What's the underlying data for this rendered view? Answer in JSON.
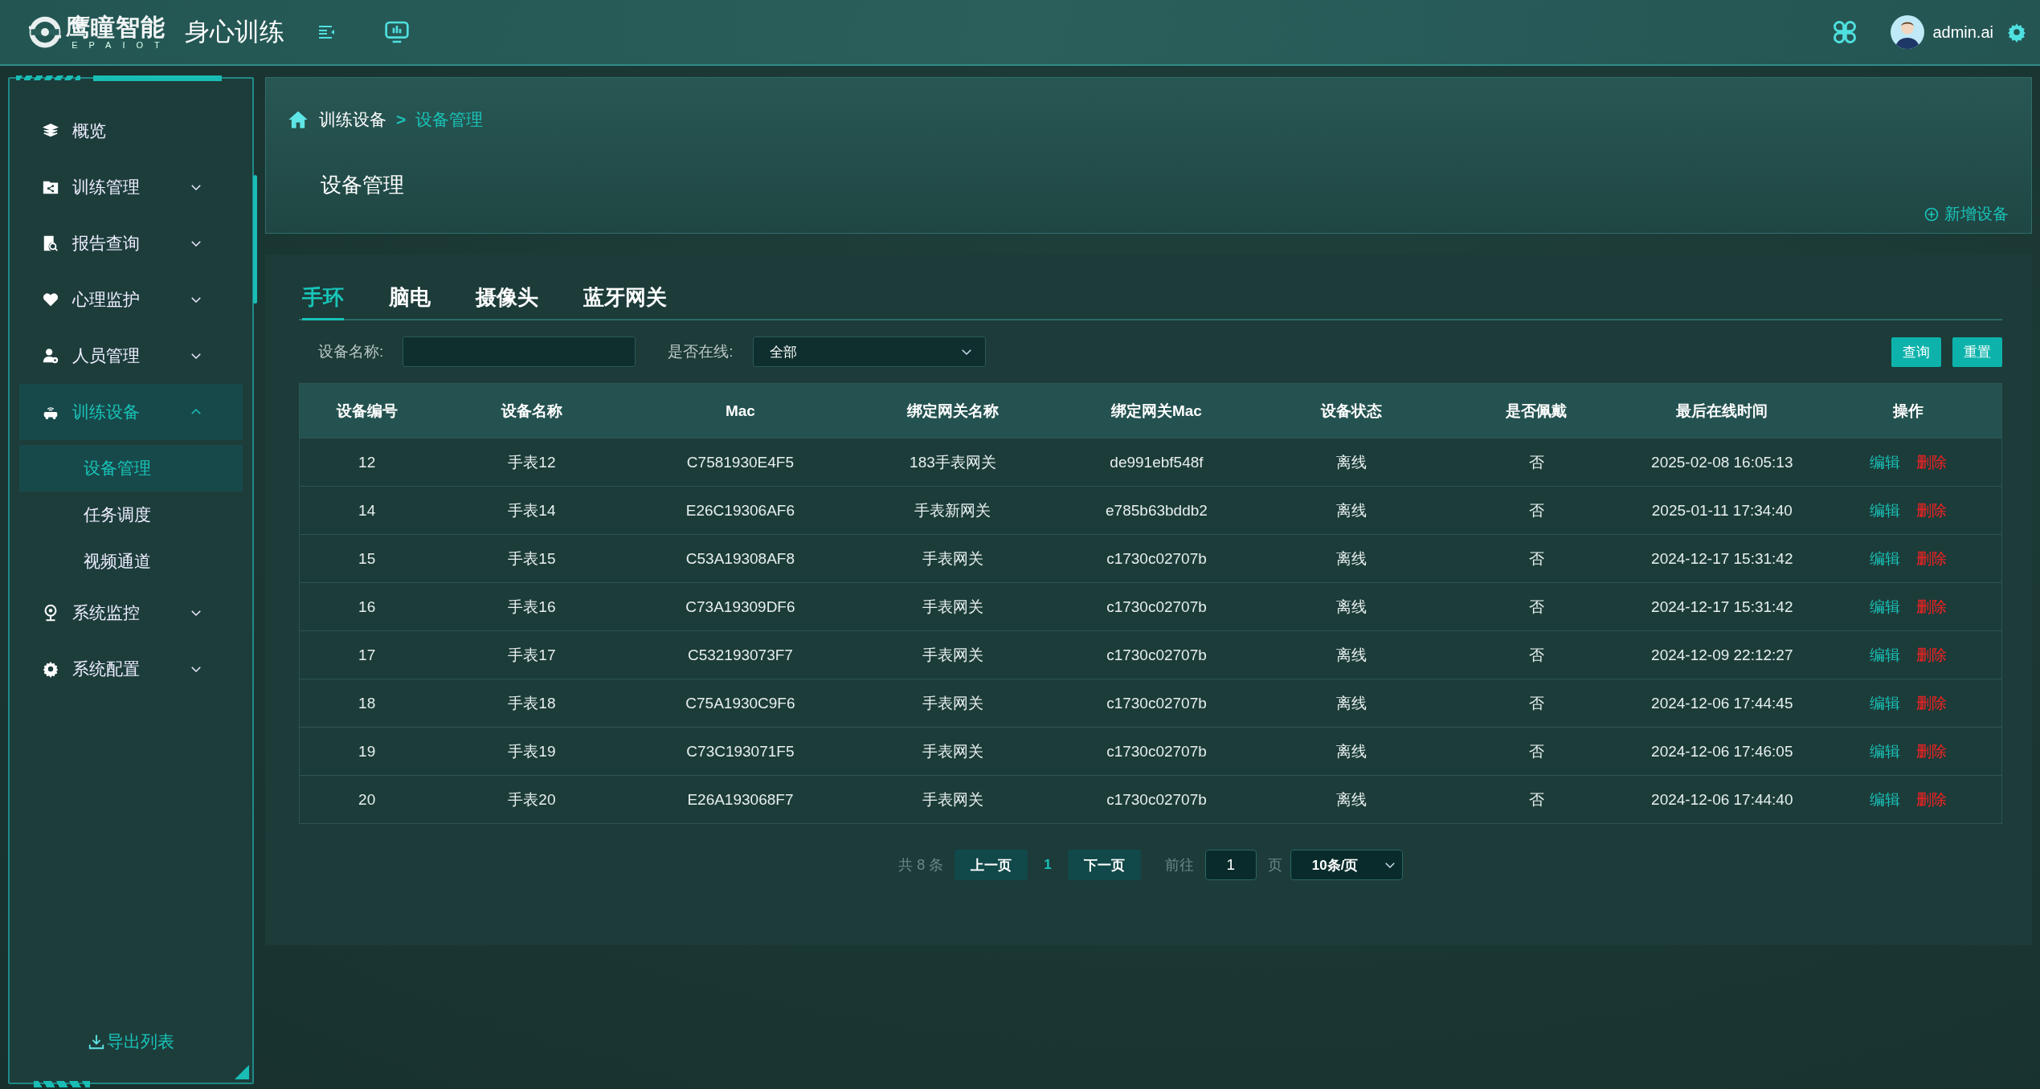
{
  "topbar": {
    "brand": "鹰瞳智能",
    "brand_sub": "EPAIOT",
    "app_title": "身心训练",
    "username": "admin.ai"
  },
  "sidebar": {
    "items": [
      {
        "label": "概览",
        "kind": "link",
        "selected": false
      },
      {
        "label": "训练管理",
        "kind": "group",
        "selected": false,
        "expanded": false
      },
      {
        "label": "报告查询",
        "kind": "group",
        "selected": false,
        "expanded": false
      },
      {
        "label": "心理监护",
        "kind": "group",
        "selected": false,
        "expanded": false
      },
      {
        "label": "人员管理",
        "kind": "group",
        "selected": false,
        "expanded": false
      },
      {
        "label": "训练设备",
        "kind": "group",
        "selected": true,
        "expanded": true,
        "children": [
          {
            "label": "设备管理",
            "selected": true
          },
          {
            "label": "任务调度",
            "selected": false
          },
          {
            "label": "视频通道",
            "selected": false
          }
        ]
      },
      {
        "label": "系统监控",
        "kind": "group",
        "selected": false,
        "expanded": false
      },
      {
        "label": "系统配置",
        "kind": "group",
        "selected": false,
        "expanded": false
      }
    ],
    "export": "导出列表"
  },
  "breadcrumb": {
    "items": [
      "训练设备",
      "设备管理"
    ],
    "separator": ">"
  },
  "page_title": "设备管理",
  "add_button": "新增设备",
  "tabs": [
    {
      "label": "手环",
      "selected": true
    },
    {
      "label": "脑电",
      "selected": false
    },
    {
      "label": "摄像头",
      "selected": false
    },
    {
      "label": "蓝牙网关",
      "selected": false
    }
  ],
  "filters": [
    {
      "label": "设备名称:",
      "kind": "text"
    },
    {
      "label": "是否在线:",
      "kind": "select",
      "value": "全部"
    }
  ],
  "filter_buttons": [
    "查询",
    "重置"
  ],
  "table": {
    "columns": [
      "设备编号",
      "设备名称",
      "Mac",
      "绑定网关名称",
      "绑定网关Mac",
      "设备状态",
      "是否佩戴",
      "最后在线时间",
      "操作"
    ],
    "rows": [
      {
        "cells": [
          "12",
          "手表12",
          "C7581930E4F5",
          "183手表网关",
          "de991ebf548f",
          "离线",
          "否",
          "2025-02-08 16:05:13"
        ],
        "actions": [
          {
            "label": "编辑",
            "kind": "edit"
          },
          {
            "label": "删除",
            "kind": "delete"
          }
        ]
      },
      {
        "cells": [
          "14",
          "手表14",
          "E26C19306AF6",
          "手表新网关",
          "e785b63bddb2",
          "离线",
          "否",
          "2025-01-11 17:34:40"
        ],
        "actions": [
          {
            "label": "编辑",
            "kind": "edit"
          },
          {
            "label": "删除",
            "kind": "delete"
          }
        ]
      },
      {
        "cells": [
          "15",
          "手表15",
          "C53A19308AF8",
          "手表网关",
          "c1730c02707b",
          "离线",
          "否",
          "2024-12-17 15:31:42"
        ],
        "actions": [
          {
            "label": "编辑",
            "kind": "edit"
          },
          {
            "label": "删除",
            "kind": "delete"
          }
        ]
      },
      {
        "cells": [
          "16",
          "手表16",
          "C73A19309DF6",
          "手表网关",
          "c1730c02707b",
          "离线",
          "否",
          "2024-12-17 15:31:42"
        ],
        "actions": [
          {
            "label": "编辑",
            "kind": "edit"
          },
          {
            "label": "删除",
            "kind": "delete"
          }
        ]
      },
      {
        "cells": [
          "17",
          "手表17",
          "C532193073F7",
          "手表网关",
          "c1730c02707b",
          "离线",
          "否",
          "2024-12-09 22:12:27"
        ],
        "actions": [
          {
            "label": "编辑",
            "kind": "edit"
          },
          {
            "label": "删除",
            "kind": "delete"
          }
        ]
      },
      {
        "cells": [
          "18",
          "手表18",
          "C75A1930C9F6",
          "手表网关",
          "c1730c02707b",
          "离线",
          "否",
          "2024-12-06 17:44:45"
        ],
        "actions": [
          {
            "label": "编辑",
            "kind": "edit"
          },
          {
            "label": "删除",
            "kind": "delete"
          }
        ]
      },
      {
        "cells": [
          "19",
          "手表19",
          "C73C193071F5",
          "手表网关",
          "c1730c02707b",
          "离线",
          "否",
          "2024-12-06 17:46:05"
        ],
        "actions": [
          {
            "label": "编辑",
            "kind": "edit"
          },
          {
            "label": "删除",
            "kind": "delete"
          }
        ]
      },
      {
        "cells": [
          "20",
          "手表20",
          "E26A193068F7",
          "手表网关",
          "c1730c02707b",
          "离线",
          "否",
          "2024-12-06 17:44:40"
        ],
        "actions": [
          {
            "label": "编辑",
            "kind": "edit"
          },
          {
            "label": "删除",
            "kind": "delete"
          }
        ]
      }
    ]
  },
  "pagination": {
    "total": "共 8 条",
    "prev": "上一页",
    "current": "1",
    "next": "下一页",
    "goto_label": "前往",
    "goto_value": "1",
    "page_unit": "页",
    "page_size": "10条/页"
  }
}
